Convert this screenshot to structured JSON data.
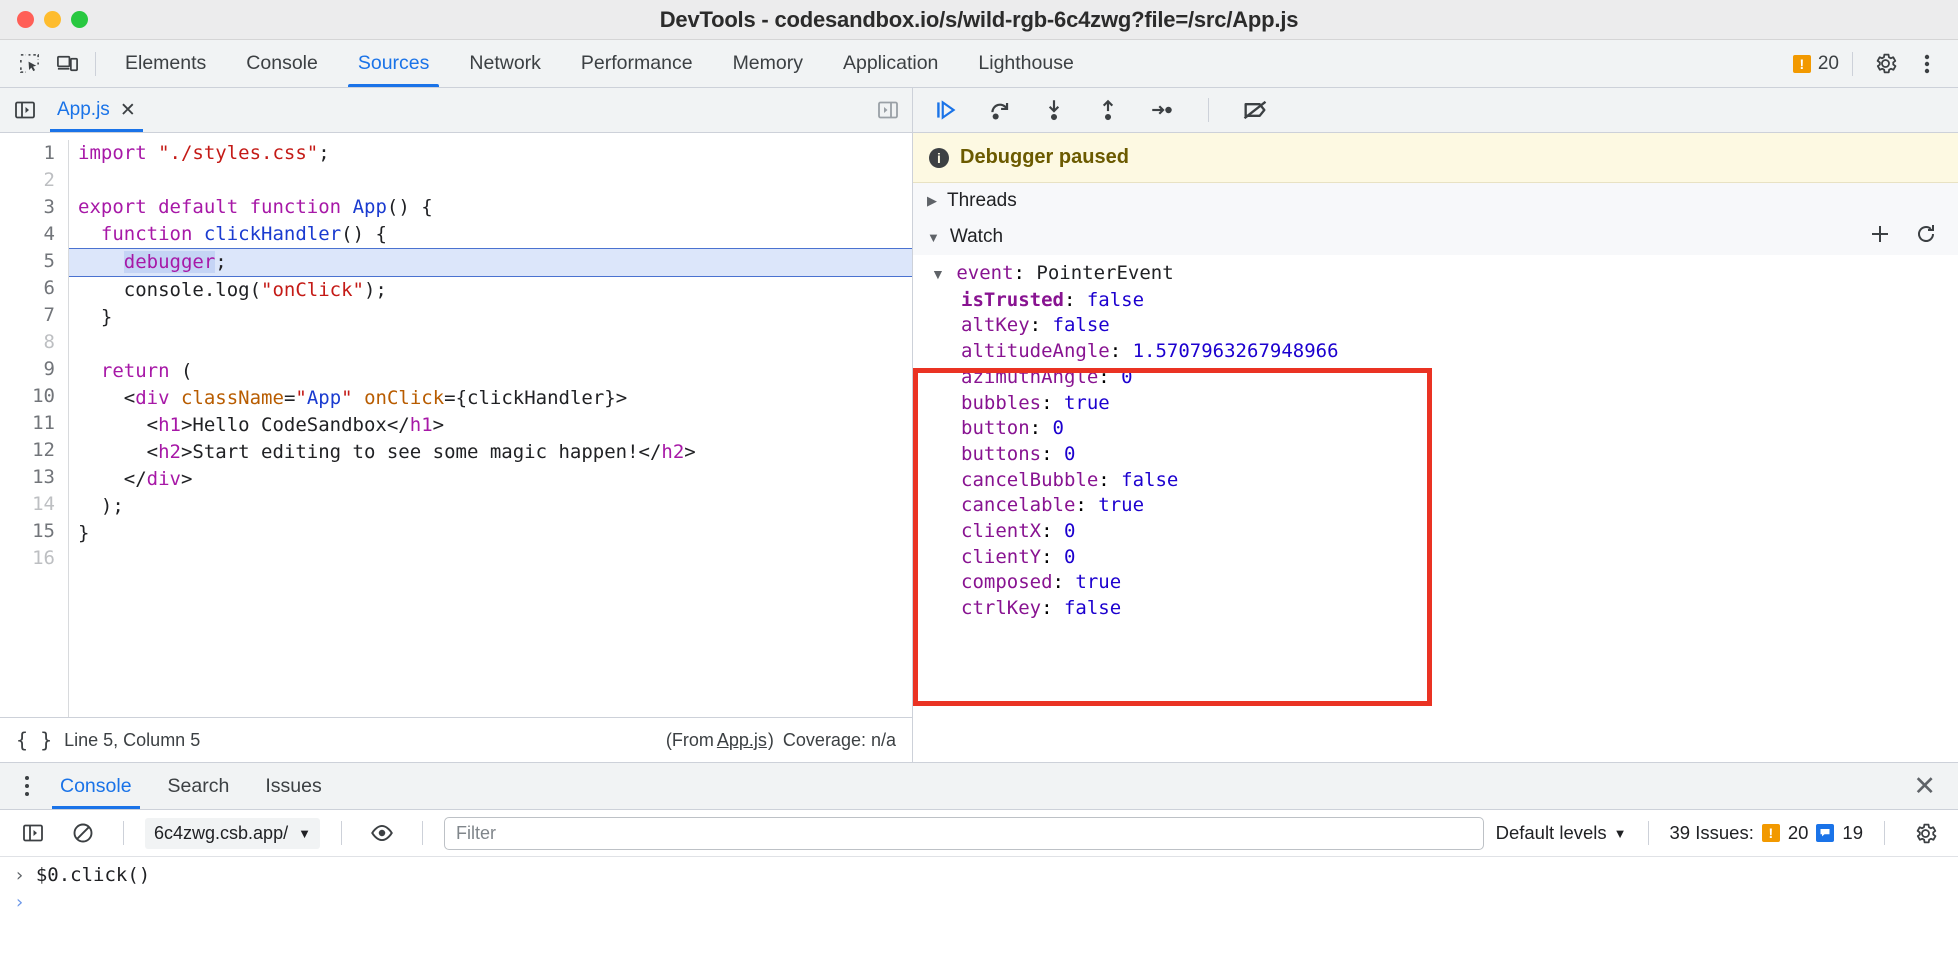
{
  "window": {
    "title": "DevTools - codesandbox.io/s/wild-rgb-6c4zwg?file=/src/App.js"
  },
  "toolbar": {
    "icons": {
      "inspect": "inspect-element-icon",
      "device": "device-toolbar-icon"
    },
    "tabs": [
      {
        "label": "Elements",
        "active": false
      },
      {
        "label": "Console",
        "active": false
      },
      {
        "label": "Sources",
        "active": true
      },
      {
        "label": "Network",
        "active": false
      },
      {
        "label": "Performance",
        "active": false
      },
      {
        "label": "Memory",
        "active": false
      },
      {
        "label": "Application",
        "active": false
      },
      {
        "label": "Lighthouse",
        "active": false
      }
    ],
    "warning_count": "20",
    "warning_glyph": "!",
    "settings_icon": "gear-icon",
    "more_icon": "kebab-menu-icon"
  },
  "editor": {
    "navigator_toggle_icon": "show-navigator-icon",
    "file_tab": {
      "label": "App.js",
      "close": "✕"
    },
    "more_panes_icon": "show-debugger-icon",
    "line_numbers": [
      "1",
      "2",
      "3",
      "4",
      "5",
      "6",
      "7",
      "8",
      "9",
      "10",
      "11",
      "12",
      "13",
      "14",
      "15",
      "16"
    ],
    "dim_lines": [
      "2",
      "8",
      "14",
      "16"
    ],
    "paused_line": "5",
    "code": [
      "import \"./styles.css\";",
      "",
      "export default function App() {",
      "  function clickHandler() {",
      "    debugger;",
      "    console.log(\"onClick\");",
      "  }",
      "",
      "  return (",
      "    <div className=\"App\" onClick={clickHandler}>",
      "      <h1>Hello CodeSandbox</h1>",
      "      <h2>Start editing to see some magic happen!</h2>",
      "    </div>",
      "  );",
      "}",
      ""
    ],
    "status": {
      "format_icon": "{ }",
      "cursor": "Line 5, Column 5",
      "from_prefix": "(From",
      "from_file": "App.js",
      "from_suffix": ")",
      "coverage": "Coverage: n/a"
    }
  },
  "debugger": {
    "controls": [
      {
        "name": "resume-script-execution",
        "glyph": "resume"
      },
      {
        "name": "step-over-next-function-call",
        "glyph": "step-over"
      },
      {
        "name": "step-into-next-function-call",
        "glyph": "step-into"
      },
      {
        "name": "step-out-of-current-function",
        "glyph": "step-out"
      },
      {
        "name": "step",
        "glyph": "step"
      },
      {
        "name": "deactivate-breakpoints",
        "glyph": "deactivate-breakpoints"
      }
    ],
    "paused_banner": "Debugger paused",
    "paused_icon_glyph": "i",
    "threads": {
      "label": "Threads",
      "expanded": false,
      "triangle": "▶"
    },
    "watch": {
      "label": "Watch",
      "expanded": true,
      "triangle": "▼",
      "add_icon": "plus-icon",
      "refresh_icon": "refresh-icon",
      "root": {
        "triangle": "▼",
        "name": "event",
        "value": "PointerEvent"
      },
      "properties": [
        {
          "name": "isTrusted",
          "value": "false",
          "type": "bool",
          "own": true
        },
        {
          "name": "altKey",
          "value": "false",
          "type": "bool",
          "own": false
        },
        {
          "name": "altitudeAngle",
          "value": "1.5707963267948966",
          "type": "num",
          "own": false
        },
        {
          "name": "azimuthAngle",
          "value": "0",
          "type": "num",
          "own": false
        },
        {
          "name": "bubbles",
          "value": "true",
          "type": "bool",
          "own": false
        },
        {
          "name": "button",
          "value": "0",
          "type": "num",
          "own": false
        },
        {
          "name": "buttons",
          "value": "0",
          "type": "num",
          "own": false
        },
        {
          "name": "cancelBubble",
          "value": "false",
          "type": "bool",
          "own": false
        },
        {
          "name": "cancelable",
          "value": "true",
          "type": "bool",
          "own": false
        },
        {
          "name": "clientX",
          "value": "0",
          "type": "num",
          "own": false
        },
        {
          "name": "clientY",
          "value": "0",
          "type": "num",
          "own": false
        },
        {
          "name": "composed",
          "value": "true",
          "type": "bool",
          "own": false
        },
        {
          "name": "ctrlKey",
          "value": "false",
          "type": "bool",
          "own": false
        }
      ]
    }
  },
  "annotation": {
    "color": "#ea3323",
    "target": "watch-panel-contents"
  },
  "drawer": {
    "tabs": [
      {
        "label": "Console",
        "active": true
      },
      {
        "label": "Search",
        "active": false
      },
      {
        "label": "Issues",
        "active": false
      }
    ],
    "close_glyph": "✕",
    "console_toolbar": {
      "sidebar_icon": "show-console-sidebar-icon",
      "clear_icon": "clear-console-icon",
      "context": "6c4zwg.csb.app/",
      "context_caret": "▼",
      "eye_icon": "live-expression-icon",
      "filter_placeholder": "Filter",
      "filter_value": "",
      "levels_label": "Default levels",
      "levels_caret": "▼",
      "issues_label": "39 Issues:",
      "issues_warning_count": "20",
      "issues_info_count": "19",
      "settings_icon": "console-settings-icon"
    },
    "entries": [
      {
        "prompt": "›",
        "text": "$0.click()",
        "kind": "input"
      }
    ],
    "active_prompt": "›"
  },
  "colors": {
    "accent": "#1a73e8",
    "warning": "#f29900",
    "info": "#1a73e8",
    "paused_bg": "#fdf9e2",
    "annotation": "#ea3323"
  }
}
